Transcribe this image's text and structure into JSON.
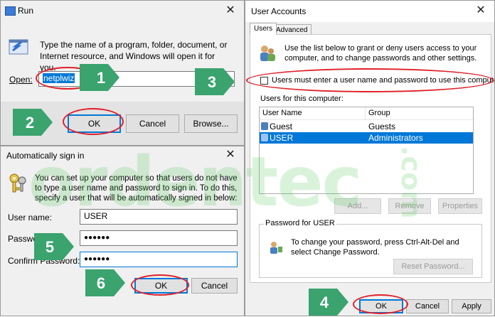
{
  "run": {
    "title": "Run",
    "description": "Type the name of a program, folder, document, or Internet resource, and Windows will open it for you.",
    "open_label": "Open:",
    "open_value": "netplwiz",
    "ok": "OK",
    "cancel": "Cancel",
    "browse": "Browse..."
  },
  "auto": {
    "title": "Automatically sign in",
    "description": "You can set up your computer so that users do not have to type a user name and password to sign in. To do this, specify a user that will be automatically signed in below:",
    "username_label": "User name:",
    "username_value": "USER",
    "password_label": "Password:",
    "password_value": "●●●●●●",
    "confirm_label": "Confirm Password:",
    "confirm_value": "●●●●●●",
    "ok": "OK",
    "cancel": "Cancel"
  },
  "ua": {
    "title": "User Accounts",
    "tabs": [
      "Users",
      "Advanced"
    ],
    "description": "Use the list below to grant or deny users access to your computer, and to change passwords and other settings.",
    "checkbox_label": "Users must enter a user name and password to use this computer.",
    "users_header": "Users for this computer:",
    "columns": [
      "User Name",
      "Group"
    ],
    "rows": [
      {
        "name": "Guest",
        "group": "Guests"
      },
      {
        "name": "USER",
        "group": "Administrators"
      }
    ],
    "add": "Add...",
    "remove": "Remove",
    "properties": "Properties",
    "password_group": "Password for USER",
    "password_text": "To change your password, press Ctrl-Alt-Del and select Change Password.",
    "reset": "Reset Password...",
    "ok": "OK",
    "cancel": "Cancel",
    "apply": "Apply"
  },
  "badges": [
    "1",
    "2",
    "3",
    "4",
    "5",
    "6"
  ],
  "watermark": "ordentec",
  "watermark_com": ".com",
  "colors": {
    "badge": "#3aa36e",
    "highlight": "#e0202a",
    "selection": "#0078d7"
  }
}
